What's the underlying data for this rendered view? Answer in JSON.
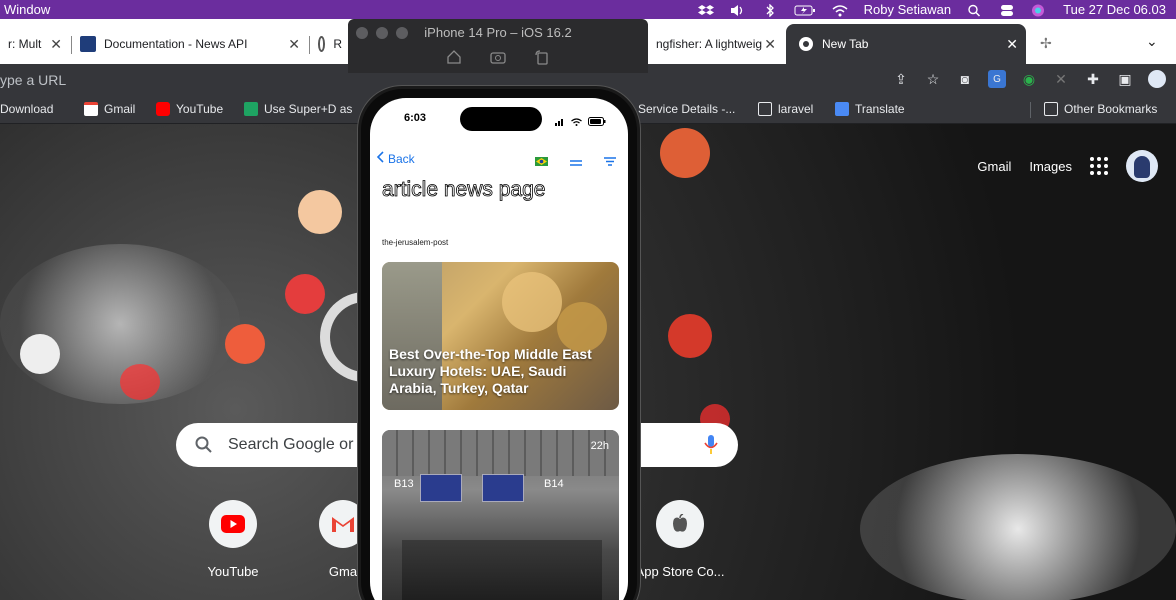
{
  "menubar": {
    "left_label": "Window",
    "user": "Roby Setiawan",
    "datetime": "Tue 27 Dec  06.03"
  },
  "tabs": [
    {
      "label": "r: Mult",
      "icon": "generic-icon"
    },
    {
      "label": "Documentation - News API",
      "icon": "newsapi-icon"
    },
    {
      "label": "R",
      "icon": "github-icon"
    },
    {
      "label": "ngfisher: A lightweig",
      "icon": "generic-icon"
    },
    {
      "label": "New Tab",
      "icon": "chrome-icon"
    }
  ],
  "omnibox": {
    "placeholder": "ype a URL"
  },
  "bookmarks": [
    {
      "label": "Download",
      "icon": "folder-icon"
    },
    {
      "label": "Gmail",
      "icon": "gmail-icon"
    },
    {
      "label": "YouTube",
      "icon": "youtube-icon"
    },
    {
      "label": "Use Super+D as",
      "icon": "sheets-icon"
    },
    {
      "label": "Service Details -...",
      "icon": "generic-icon"
    },
    {
      "label": "laravel",
      "icon": "folder-icon"
    },
    {
      "label": "Translate",
      "icon": "translate-icon"
    },
    {
      "label": "Other Bookmarks",
      "icon": "folder-icon"
    }
  ],
  "ntp": {
    "gmail_link": "Gmail",
    "images_link": "Images",
    "search_placeholder": "Search Google or t",
    "shortcuts": [
      {
        "label": "YouTube"
      },
      {
        "label": "Gma"
      },
      {
        "label": "App Store Co..."
      }
    ]
  },
  "simulator": {
    "title": "iPhone 14 Pro – iOS 16.2"
  },
  "phone": {
    "time": "6:03",
    "back_label": "Back",
    "page_title": "article news page",
    "source": "the-jerusalem-post",
    "articles": [
      {
        "headline": "Best Over-the-Top Middle East Luxury Hotels: UAE, Saudi Arabia, Turkey, Qatar"
      },
      {
        "age": "22h",
        "sign_left": "B13",
        "sign_right": "B14"
      }
    ]
  }
}
